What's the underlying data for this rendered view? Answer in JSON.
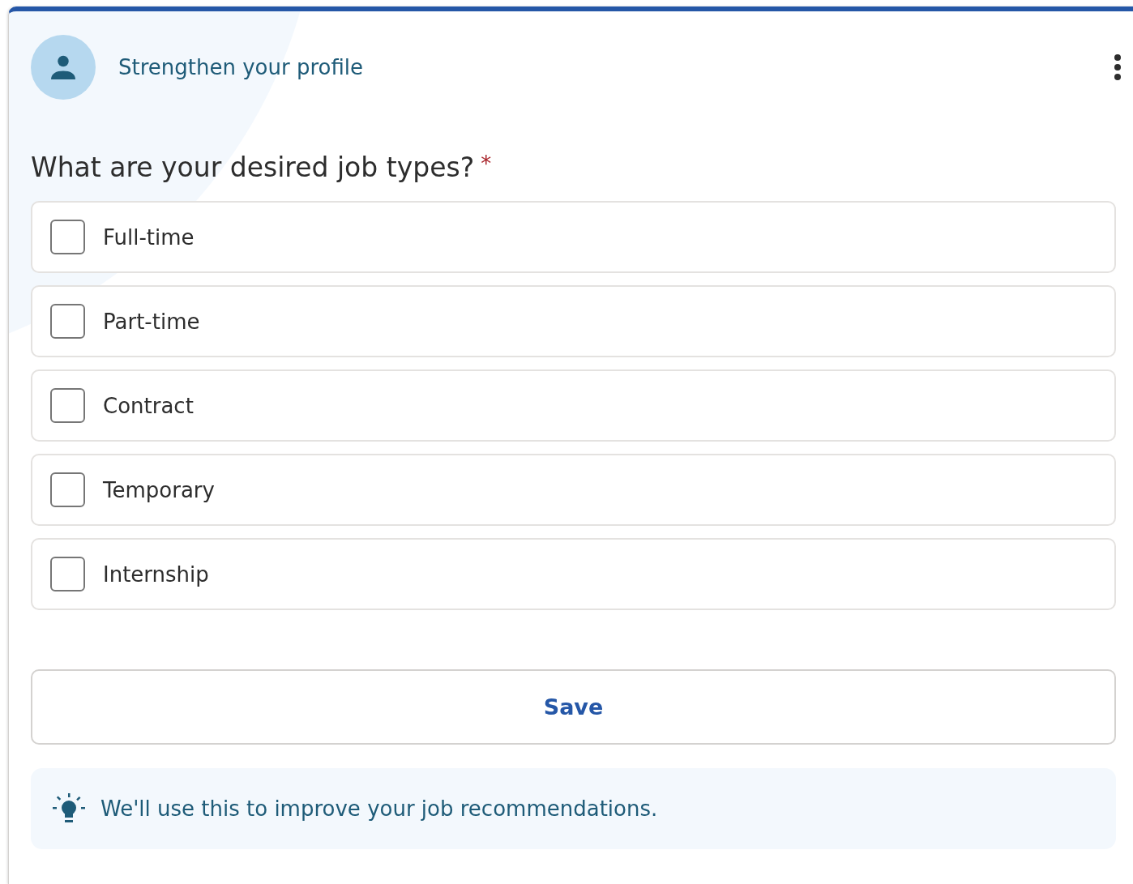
{
  "header": {
    "title": "Strengthen your profile"
  },
  "question": {
    "text": "What are your desired job types?",
    "required_mark": "*"
  },
  "options": [
    {
      "label": "Full-time",
      "checked": false
    },
    {
      "label": "Part-time",
      "checked": false
    },
    {
      "label": "Contract",
      "checked": false
    },
    {
      "label": "Temporary",
      "checked": false
    },
    {
      "label": "Internship",
      "checked": false
    }
  ],
  "save_button": "Save",
  "info": "We'll use this to improve your job recommendations."
}
